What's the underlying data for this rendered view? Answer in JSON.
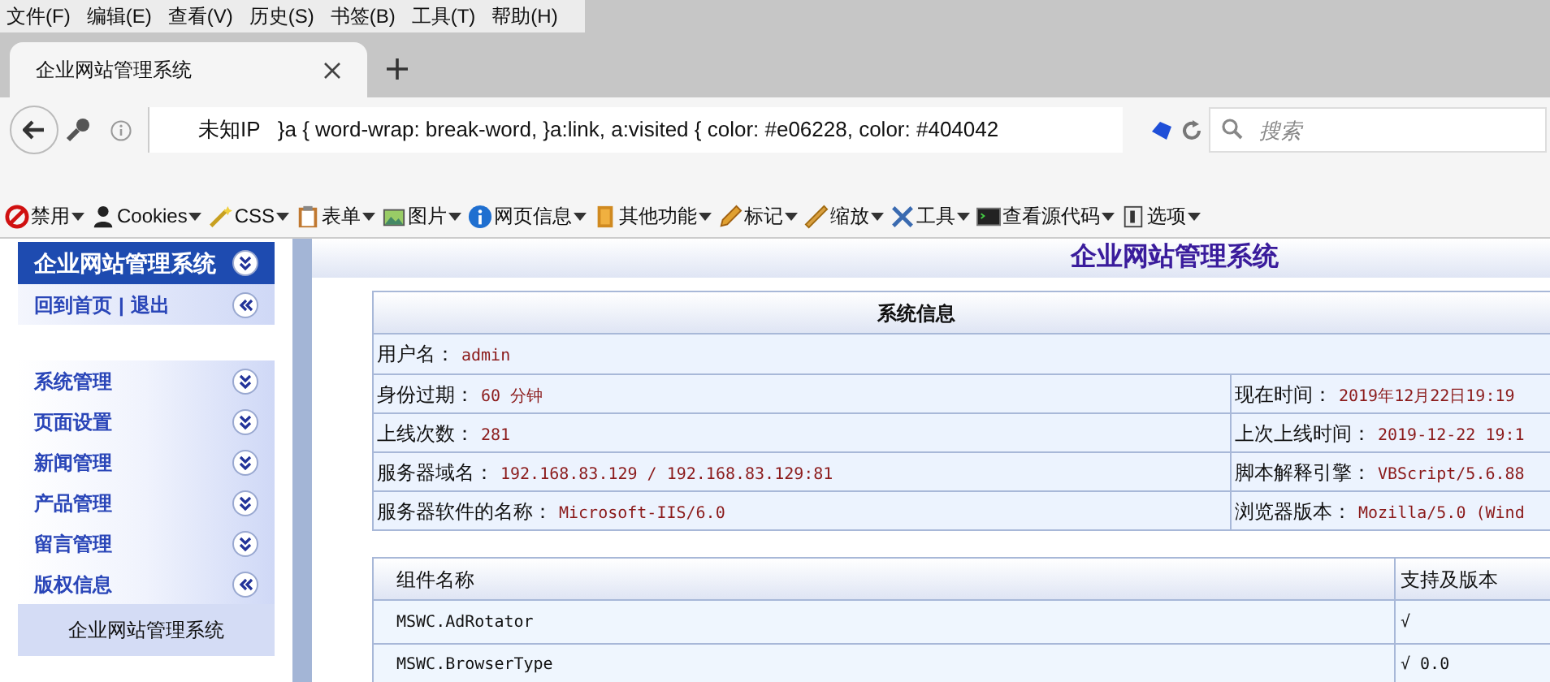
{
  "menu_bar": [
    "文件(F)",
    "编辑(E)",
    "查看(V)",
    "历史(S)",
    "书签(B)",
    "工具(T)",
    "帮助(H)"
  ],
  "tabs": [
    {
      "title": "企业网站管理系统",
      "selected": true
    }
  ],
  "address_bar": {
    "value": "未知IP   }a { word-wrap: break-word, }a:link, a:visited { color: #e06228, color: #404042"
  },
  "search": {
    "placeholder": "搜索"
  },
  "toolbar": [
    {
      "label": "禁用"
    },
    {
      "label": "Cookies"
    },
    {
      "label": "CSS"
    },
    {
      "label": "表单"
    },
    {
      "label": "图片"
    },
    {
      "label": "网页信息"
    },
    {
      "label": "其他功能"
    },
    {
      "label": "标记"
    },
    {
      "label": "缩放"
    },
    {
      "label": "工具"
    },
    {
      "label": "查看源代码"
    },
    {
      "label": "选项"
    }
  ],
  "sidebar": {
    "title": "企业网站管理系统",
    "links": [
      "回到首页",
      "退出"
    ],
    "separator": "|",
    "sections": [
      {
        "label": "系统管理",
        "expanded": false
      },
      {
        "label": "页面设置",
        "expanded": false
      },
      {
        "label": "新闻管理",
        "expanded": false
      },
      {
        "label": "产品管理",
        "expanded": false
      },
      {
        "label": "留言管理",
        "expanded": false
      },
      {
        "label": "版权信息",
        "expanded": true,
        "children": [
          "企业网站管理系统"
        ]
      }
    ]
  },
  "page_title": "企业网站管理系统",
  "system_info": {
    "title": "系统信息",
    "rows": [
      {
        "label": "用户名：",
        "value": "admin"
      },
      {
        "label": "身份过期：",
        "value": "60 分钟",
        "label2": "现在时间：",
        "value2": "2019年12月22日19:19"
      },
      {
        "label": "上线次数：",
        "value": "281",
        "label2": "上次上线时间：",
        "value2": "2019-12-22 19:1"
      },
      {
        "label": "服务器域名：",
        "value": "192.168.83.129 / 192.168.83.129:81",
        "label2": "脚本解释引擎：",
        "value2": "VBScript/5.6.88"
      },
      {
        "label": "服务器软件的名称：",
        "value": "Microsoft-IIS/6.0",
        "label2": "浏览器版本：",
        "value2": "Mozilla/5.0 (Wind"
      }
    ]
  },
  "components": {
    "columns": [
      "组件名称",
      "支持及版本"
    ],
    "rows": [
      {
        "name": "MSWC.AdRotator",
        "support": "√"
      },
      {
        "name": "MSWC.BrowserType",
        "support": "√ 0.0"
      }
    ]
  }
}
